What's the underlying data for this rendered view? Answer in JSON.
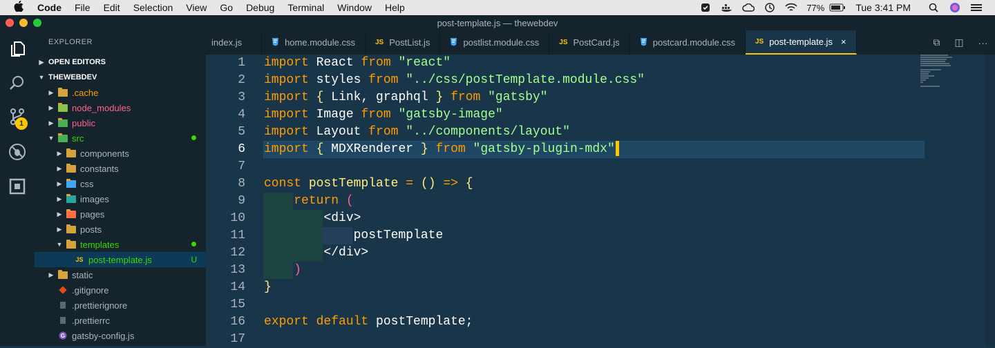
{
  "menubar": {
    "apple": "",
    "items": [
      "Code",
      "File",
      "Edit",
      "Selection",
      "View",
      "Go",
      "Debug",
      "Terminal",
      "Window",
      "Help"
    ],
    "battery": "77%",
    "clock": "Tue 3:41 PM"
  },
  "window": {
    "title": "post-template.js — thewebdev",
    "traffic_colors": [
      "#fd5f57",
      "#fdbc2e",
      "#28c840"
    ]
  },
  "activity": {
    "icons": [
      "files-icon",
      "search-icon",
      "source-control-icon",
      "debug-icon",
      "extensions-icon"
    ],
    "badge": "1"
  },
  "sidebar": {
    "header": "EXPLORER",
    "open_editors": "OPEN EDITORS",
    "project": "THEWEBDEV",
    "tree": [
      {
        "label": ".cache",
        "depth": 0,
        "kind": "folder",
        "color": "#ff9d00",
        "caret": "▶"
      },
      {
        "label": "node_modules",
        "depth": 0,
        "kind": "folder",
        "color": "#ff628c",
        "caret": "▶",
        "icon_color": "#8bc34a"
      },
      {
        "label": "public",
        "depth": 0,
        "kind": "folder",
        "color": "#ff628c",
        "caret": "▶",
        "icon_color": "#4caf50"
      },
      {
        "label": "src",
        "depth": 0,
        "kind": "folder",
        "color": "#3ad900",
        "caret": "▼",
        "dot": true,
        "icon_color": "#4caf50"
      },
      {
        "label": "components",
        "depth": 1,
        "kind": "folder",
        "color": "#aab5be",
        "caret": "▶",
        "icon_color": "#d6a33c"
      },
      {
        "label": "constants",
        "depth": 1,
        "kind": "folder",
        "color": "#aab5be",
        "caret": "▶",
        "icon_color": "#d6a33c"
      },
      {
        "label": "css",
        "depth": 1,
        "kind": "folder",
        "color": "#aab5be",
        "caret": "▶",
        "icon_color": "#42a5f5"
      },
      {
        "label": "images",
        "depth": 1,
        "kind": "folder",
        "color": "#aab5be",
        "caret": "▶",
        "icon_color": "#26a69a"
      },
      {
        "label": "pages",
        "depth": 1,
        "kind": "folder",
        "color": "#aab5be",
        "caret": "▶",
        "icon_color": "#ff7043"
      },
      {
        "label": "posts",
        "depth": 1,
        "kind": "folder",
        "color": "#aab5be",
        "caret": "▶",
        "icon_color": "#d6a33c"
      },
      {
        "label": "templates",
        "depth": 1,
        "kind": "folder",
        "color": "#3ad900",
        "caret": "▼",
        "dot": true,
        "icon_color": "#d6a33c"
      },
      {
        "label": "post-template.js",
        "depth": 2,
        "kind": "js",
        "color": "#3ad900",
        "caret": "",
        "status": "U",
        "active": true
      },
      {
        "label": "static",
        "depth": 0,
        "kind": "folder",
        "color": "#aab5be",
        "caret": "▶",
        "icon_color": "#d6a33c"
      },
      {
        "label": ".gitignore",
        "depth": 0,
        "kind": "git",
        "color": "#aab5be",
        "caret": ""
      },
      {
        "label": ".prettierignore",
        "depth": 0,
        "kind": "file",
        "color": "#aab5be",
        "caret": ""
      },
      {
        "label": ".prettierrc",
        "depth": 0,
        "kind": "file",
        "color": "#aab5be",
        "caret": ""
      },
      {
        "label": "gatsby-config.js",
        "depth": 0,
        "kind": "gatsby",
        "color": "#aab5be",
        "caret": ""
      }
    ]
  },
  "tabs": [
    {
      "label": "index.js",
      "icon": "",
      "active": false
    },
    {
      "label": "home.module.css",
      "icon": "css",
      "active": false
    },
    {
      "label": "PostList.js",
      "icon": "JS",
      "active": false
    },
    {
      "label": "postlist.module.css",
      "icon": "css",
      "active": false
    },
    {
      "label": "PostCard.js",
      "icon": "JS",
      "active": false
    },
    {
      "label": "postcard.module.css",
      "icon": "css",
      "active": false
    },
    {
      "label": "post-template.js",
      "icon": "JS",
      "active": true,
      "close": "×"
    }
  ],
  "editor": {
    "current_line": 6,
    "lines": [
      {
        "n": "1",
        "tokens": [
          [
            "k",
            "import"
          ],
          [
            "t",
            " React "
          ],
          [
            "k",
            "from"
          ],
          [
            "t",
            " "
          ],
          [
            "s",
            "\"react\""
          ]
        ]
      },
      {
        "n": "2",
        "tokens": [
          [
            "k",
            "import"
          ],
          [
            "t",
            " styles "
          ],
          [
            "k",
            "from"
          ],
          [
            "t",
            " "
          ],
          [
            "s",
            "\"../css/postTemplate.module.css\""
          ]
        ]
      },
      {
        "n": "3",
        "tokens": [
          [
            "k",
            "import"
          ],
          [
            "t",
            " "
          ],
          [
            "b",
            "{"
          ],
          [
            "t",
            " Link, graphql "
          ],
          [
            "b",
            "}"
          ],
          [
            "t",
            " "
          ],
          [
            "k",
            "from"
          ],
          [
            "t",
            " "
          ],
          [
            "s",
            "\"gatsby\""
          ]
        ]
      },
      {
        "n": "4",
        "tokens": [
          [
            "k",
            "import"
          ],
          [
            "t",
            " Image "
          ],
          [
            "k",
            "from"
          ],
          [
            "t",
            " "
          ],
          [
            "s",
            "\"gatsby-image\""
          ]
        ]
      },
      {
        "n": "5",
        "tokens": [
          [
            "k",
            "import"
          ],
          [
            "t",
            " Layout "
          ],
          [
            "k",
            "from"
          ],
          [
            "t",
            " "
          ],
          [
            "s",
            "\"../components/layout\""
          ]
        ]
      },
      {
        "n": "6",
        "tokens": [
          [
            "k",
            "import"
          ],
          [
            "t",
            " "
          ],
          [
            "b",
            "{"
          ],
          [
            "t",
            " MDXRenderer "
          ],
          [
            "b",
            "}"
          ],
          [
            "t",
            " "
          ],
          [
            "k",
            "from"
          ],
          [
            "t",
            " "
          ],
          [
            "s",
            "\"gatsby-plugin-mdx\""
          ]
        ]
      },
      {
        "n": "7",
        "tokens": []
      },
      {
        "n": "8",
        "tokens": [
          [
            "k",
            "const"
          ],
          [
            "t",
            " "
          ],
          [
            "b",
            "postTemplate"
          ],
          [
            "t",
            " "
          ],
          [
            "k",
            "="
          ],
          [
            "t",
            " "
          ],
          [
            "b",
            "()"
          ],
          [
            "t",
            " "
          ],
          [
            "k",
            "=>"
          ],
          [
            "t",
            " "
          ],
          [
            "b",
            "{"
          ]
        ]
      },
      {
        "n": "9",
        "tokens": [
          [
            "t",
            "    "
          ],
          [
            "k",
            "return"
          ],
          [
            "t",
            " "
          ],
          [
            "p",
            "("
          ]
        ]
      },
      {
        "n": "10",
        "tokens": [
          [
            "t",
            "        <div>"
          ]
        ]
      },
      {
        "n": "11",
        "tokens": [
          [
            "t",
            "            postTemplate"
          ]
        ]
      },
      {
        "n": "12",
        "tokens": [
          [
            "t",
            "        </div>"
          ]
        ]
      },
      {
        "n": "13",
        "tokens": [
          [
            "t",
            "    "
          ],
          [
            "p",
            ")"
          ]
        ]
      },
      {
        "n": "14",
        "tokens": [
          [
            "b",
            "}"
          ]
        ]
      },
      {
        "n": "15",
        "tokens": []
      },
      {
        "n": "16",
        "tokens": [
          [
            "k",
            "export"
          ],
          [
            "t",
            " "
          ],
          [
            "k",
            "default"
          ],
          [
            "t",
            " postTemplate;"
          ]
        ]
      },
      {
        "n": "17",
        "tokens": []
      }
    ]
  }
}
